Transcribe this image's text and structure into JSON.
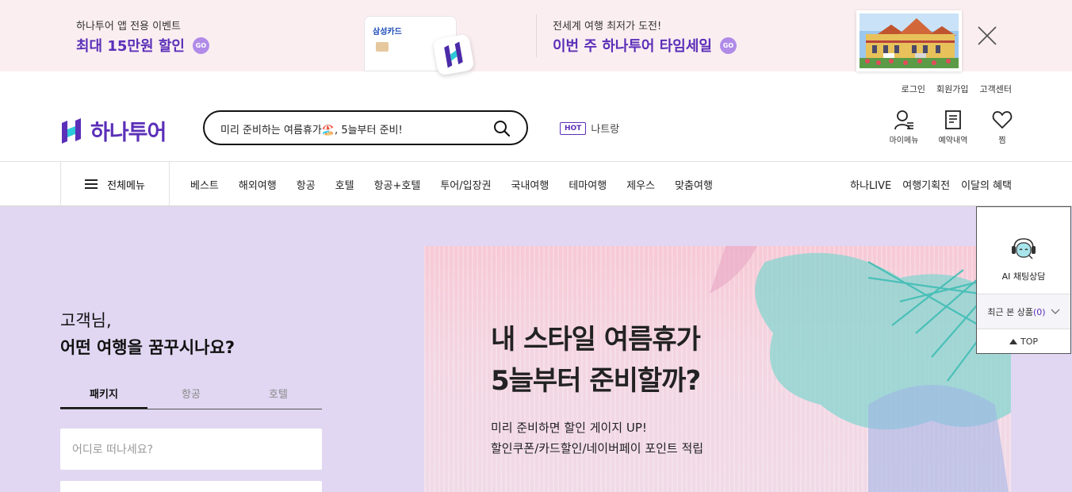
{
  "banner": {
    "promo1_sub": "하나투어 앱 전용 이벤트",
    "promo1_main": "최대 15만원 할인",
    "go_label": "GO",
    "card_brand": "삼성카드",
    "promo2_sub": "전세계 여행 최저가 도전!",
    "promo2_main": "이번 주 하나투어 타임세일"
  },
  "header": {
    "util_links": [
      "로그인",
      "회원가입",
      "고객센터"
    ],
    "logo": "하나투어",
    "search_placeholder": "미리 준비하는 여름휴가🏖️, 5늘부터 준비!",
    "hot_badge": "HOT",
    "hot_text": "나트랑",
    "icons": [
      {
        "label": "마이메뉴",
        "icon": "user-icon"
      },
      {
        "label": "예약내역",
        "icon": "document-icon"
      },
      {
        "label": "찜",
        "icon": "heart-icon"
      }
    ]
  },
  "nav": {
    "all_menu": "전체메뉴",
    "items": [
      "베스트",
      "해외여행",
      "항공",
      "호텔",
      "항공+호텔",
      "투어/입장권",
      "국내여행",
      "테마여행",
      "제우스",
      "맞춤여행"
    ],
    "right_items": [
      "하나LIVE",
      "여행기획전",
      "이달의 혜택"
    ]
  },
  "search_panel": {
    "greeting1": "고객님,",
    "greeting2": "어떤 여행을 꿈꾸시나요?",
    "tabs": [
      "패키지",
      "항공",
      "호텔"
    ],
    "active_tab": 0,
    "destination_placeholder": "어디로 떠나세요?"
  },
  "hero": {
    "title_line1": "내 스타일 여름휴가",
    "title_line2": "5늘부터 준비할까?",
    "sub_line1": "미리 준비하면 할인 게이지 UP!",
    "sub_line2": "할인쿠폰/카드할인/네이버페이 포인트 적립"
  },
  "side_panel": {
    "ai_label": "AI 채팅상담",
    "recent_label": "최근 본 상품",
    "recent_count": "(0)",
    "top_label": "TOP"
  },
  "colors": {
    "brand": "#5b2fb8",
    "banner_bg": "#fbeef1",
    "hero_bg": "#e1d7f2",
    "go_badge": "#b08be8"
  }
}
